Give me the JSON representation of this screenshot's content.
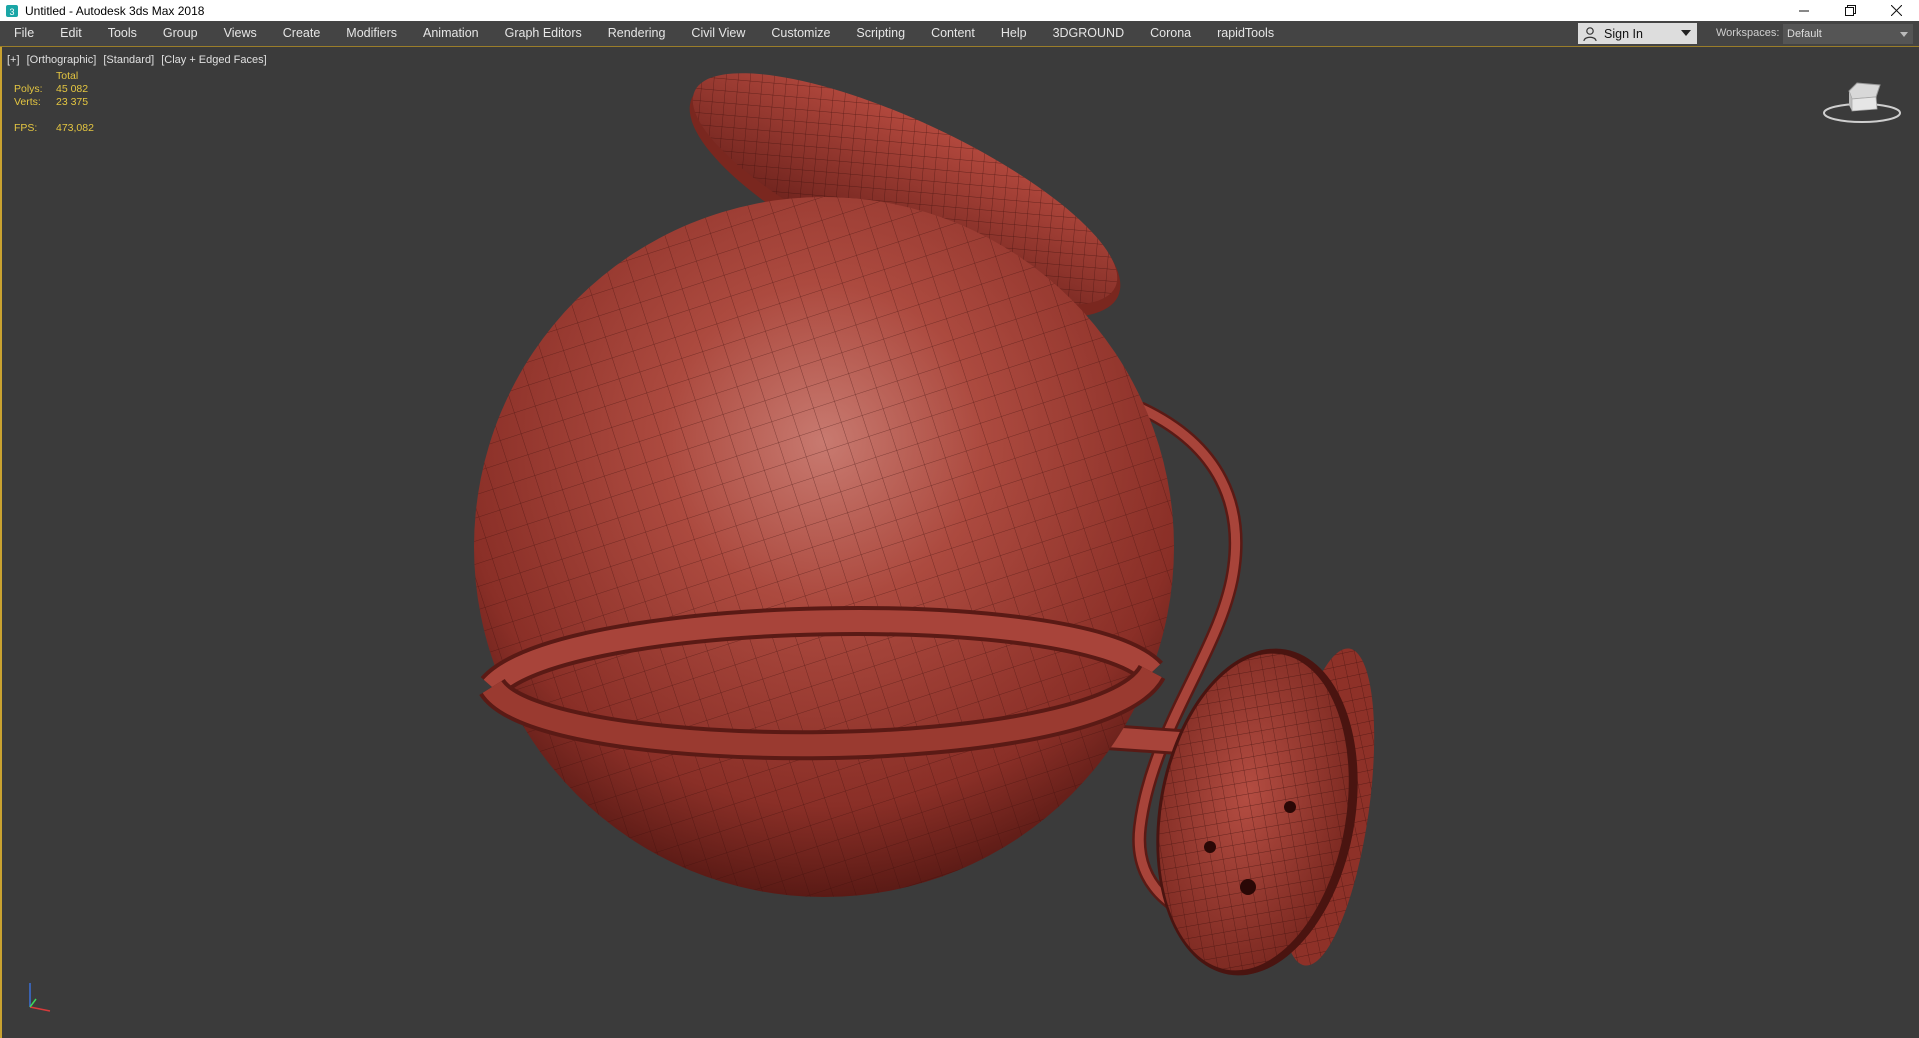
{
  "window": {
    "title": "Untitled - Autodesk 3ds Max 2018",
    "app_icon": "3ds-max-icon",
    "controls": [
      "minimize-icon",
      "restore-icon",
      "close-icon"
    ]
  },
  "menubar": {
    "items": [
      "File",
      "Edit",
      "Tools",
      "Group",
      "Views",
      "Create",
      "Modifiers",
      "Animation",
      "Graph Editors",
      "Rendering",
      "Civil View",
      "Customize",
      "Scripting",
      "Content",
      "Help",
      "3DGROUND",
      "Corona",
      "rapidTools"
    ],
    "sign_in_label": "Sign In",
    "workspaces_label": "Workspaces:",
    "workspace_value": "Default"
  },
  "viewport": {
    "label_plus": "[+]",
    "label_view": "[Orthographic]",
    "label_shading": "[Standard]",
    "label_style": "[Clay + Edged Faces]",
    "stats": {
      "header": "Total",
      "polys_label": "Polys:",
      "polys_value": "45 082",
      "verts_label": "Verts:",
      "verts_value": "23 375",
      "fps_label": "FPS:",
      "fps_value": "473,082"
    },
    "colors": {
      "background": "#3b3b3b",
      "stats_text": "#e4c641",
      "model_clay": "#a8443a",
      "active_border": "#c9a230"
    },
    "viewcube_icon": "viewcube-icon",
    "axis_icon": "axis-tripod-icon"
  }
}
